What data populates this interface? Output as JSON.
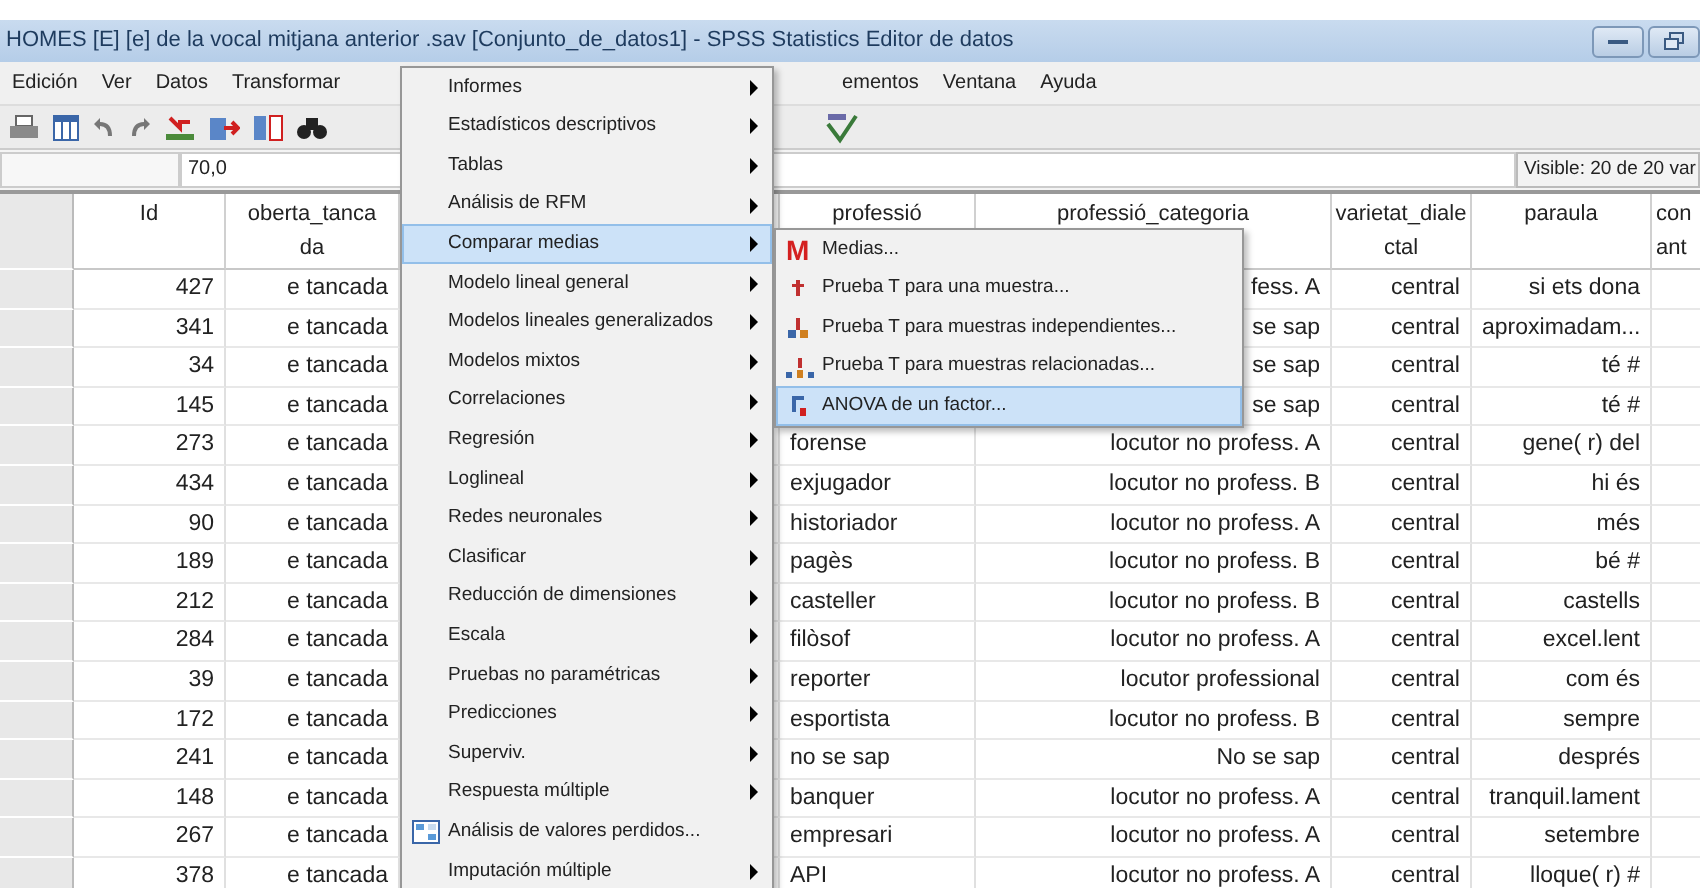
{
  "window": {
    "title": "HOMES [E] [e] de la vocal mitjana anterior .sav [Conjunto_de_datos1] - SPSS Statistics Editor de datos"
  },
  "menu_bar": [
    {
      "label": "Edición"
    },
    {
      "label": "Ver"
    },
    {
      "label": "Datos"
    },
    {
      "label": "Transformar"
    },
    {
      "label": "ementos"
    },
    {
      "label": "Ventana"
    },
    {
      "label": "Ayuda"
    }
  ],
  "cell_editor": {
    "value": "70,0",
    "visible_label": "Visible: 20 de 20 var"
  },
  "table": {
    "columns": [
      {
        "lines": [
          "Id"
        ]
      },
      {
        "lines": [
          "oberta_tanca",
          "da"
        ]
      },
      {
        "lines": [
          "professió"
        ]
      },
      {
        "lines": [
          "professió_categoria"
        ]
      },
      {
        "lines": [
          "varietat_diale",
          "ctal"
        ]
      },
      {
        "lines": [
          "paraula"
        ]
      },
      {
        "lines": [
          "con",
          "ant"
        ]
      }
    ],
    "rows": [
      {
        "id": "427",
        "oberta_tancada": "e tancada",
        "professio_categoria": "fess. A",
        "varietat_dialectal": "central",
        "paraula": "si ets dona"
      },
      {
        "id": "341",
        "oberta_tancada": "e tancada",
        "professio_categoria": "se sap",
        "varietat_dialectal": "central",
        "paraula": "aproximadam..."
      },
      {
        "id": "34",
        "oberta_tancada": "e tancada",
        "professio_categoria": "se sap",
        "varietat_dialectal": "central",
        "paraula": "té #"
      },
      {
        "id": "145",
        "oberta_tancada": "e tancada",
        "professio_categoria": "se sap",
        "varietat_dialectal": "central",
        "paraula": "té #"
      },
      {
        "id": "273",
        "oberta_tancada": "e tancada",
        "professio": "forense",
        "professio_categoria": "locutor no profess. A",
        "varietat_dialectal": "central",
        "paraula": "gene( r) del"
      },
      {
        "id": "434",
        "oberta_tancada": "e tancada",
        "professio": "exjugador",
        "professio_categoria": "locutor no profess. B",
        "varietat_dialectal": "central",
        "paraula": "hi és"
      },
      {
        "id": "90",
        "oberta_tancada": "e tancada",
        "professio": "historiador",
        "professio_categoria": "locutor no profess. A",
        "varietat_dialectal": "central",
        "paraula": "més"
      },
      {
        "id": "189",
        "oberta_tancada": "e tancada",
        "professio": "pagès",
        "professio_categoria": "locutor no profess. B",
        "varietat_dialectal": "central",
        "paraula": "bé #"
      },
      {
        "id": "212",
        "oberta_tancada": "e tancada",
        "professio": "casteller",
        "professio_categoria": "locutor no profess. B",
        "varietat_dialectal": "central",
        "paraula": "castells"
      },
      {
        "id": "284",
        "oberta_tancada": "e tancada",
        "professio": "filòsof",
        "professio_categoria": "locutor no profess. A",
        "varietat_dialectal": "central",
        "paraula": "excel.lent"
      },
      {
        "id": "39",
        "oberta_tancada": "e tancada",
        "professio": "reporter",
        "professio_categoria": "locutor professional",
        "varietat_dialectal": "central",
        "paraula": "com és"
      },
      {
        "id": "172",
        "oberta_tancada": "e tancada",
        "professio": "esportista",
        "professio_categoria": "locutor no profess. B",
        "varietat_dialectal": "central",
        "paraula": "sempre"
      },
      {
        "id": "241",
        "oberta_tancada": "e tancada",
        "professio": "no se sap",
        "professio_categoria": "No se sap",
        "varietat_dialectal": "central",
        "paraula": "després"
      },
      {
        "id": "148",
        "oberta_tancada": "e tancada",
        "professio": "banquer",
        "professio_categoria": "locutor no profess. A",
        "varietat_dialectal": "central",
        "paraula": "tranquil.lament"
      },
      {
        "id": "267",
        "oberta_tancada": "e tancada",
        "professio": "empresari",
        "professio_categoria": "locutor no profess. A",
        "varietat_dialectal": "central",
        "paraula": "setembre"
      },
      {
        "id": "378",
        "oberta_tancada": "e tancada",
        "professio": "API",
        "professio_categoria": "locutor no profess. A",
        "varietat_dialectal": "central",
        "paraula": "lloque( r) #"
      }
    ]
  },
  "analyze_menu": {
    "items": [
      {
        "label": "Informes",
        "kind": "submenu",
        "selected": false
      },
      {
        "label": "Estadísticos descriptivos",
        "kind": "submenu",
        "selected": false
      },
      {
        "label": "Tablas",
        "kind": "submenu",
        "selected": false
      },
      {
        "label": "Análisis de RFM",
        "kind": "submenu",
        "selected": false
      },
      {
        "label": "Comparar medias",
        "kind": "submenu",
        "selected": true
      },
      {
        "label": "Modelo lineal general",
        "kind": "submenu",
        "selected": false
      },
      {
        "label": "Modelos lineales generalizados",
        "kind": "submenu",
        "selected": false
      },
      {
        "label": "Modelos mixtos",
        "kind": "submenu",
        "selected": false
      },
      {
        "label": "Correlaciones",
        "kind": "submenu",
        "selected": false
      },
      {
        "label": "Regresión",
        "kind": "submenu",
        "selected": false
      },
      {
        "label": "Loglineal",
        "kind": "submenu",
        "selected": false
      },
      {
        "label": "Redes neuronales",
        "kind": "submenu",
        "selected": false
      },
      {
        "label": "Clasificar",
        "kind": "submenu",
        "selected": false
      },
      {
        "label": "Reducción de dimensiones",
        "kind": "submenu",
        "selected": false
      },
      {
        "label": "Escala",
        "kind": "submenu",
        "selected": false
      },
      {
        "label": "Pruebas no paramétricas",
        "kind": "submenu",
        "selected": false
      },
      {
        "label": "Predicciones",
        "kind": "submenu",
        "selected": false
      },
      {
        "label": "Superviv.",
        "kind": "submenu",
        "selected": false
      },
      {
        "label": "Respuesta múltiple",
        "kind": "submenu",
        "selected": false
      },
      {
        "label": "Análisis de valores perdidos...",
        "kind": "command",
        "selected": false
      },
      {
        "label": "Imputación múltiple",
        "kind": "submenu",
        "selected": false
      }
    ]
  },
  "compare_means_menu": {
    "items": [
      {
        "label": "Medias...",
        "icon_text": "M",
        "selected": false
      },
      {
        "label": "Prueba T para una muestra...",
        "selected": false
      },
      {
        "label": "Prueba T para muestras independientes...",
        "selected": false
      },
      {
        "label": "Prueba T para muestras relacionadas...",
        "selected": false
      },
      {
        "label": "ANOVA de un factor...",
        "selected": true
      }
    ]
  }
}
